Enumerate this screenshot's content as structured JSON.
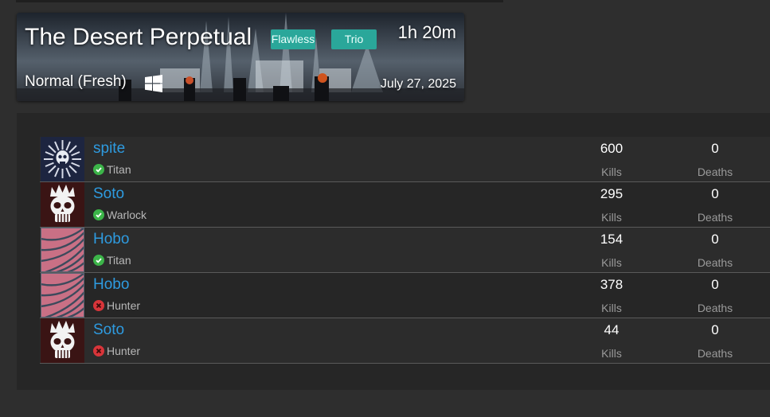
{
  "activity": {
    "title": "The Desert Perpetual",
    "badges": [
      "Flawless",
      "Trio"
    ],
    "duration": "1h 20m",
    "difficulty": "Normal (Fresh)",
    "platform_icon": "windows-icon",
    "date": "July 27, 2025"
  },
  "stat_labels": {
    "kills": "Kills",
    "deaths": "Deaths"
  },
  "players": [
    {
      "name": "spite",
      "class": "Titan",
      "completed": true,
      "kills": "600",
      "deaths": "0",
      "emblem": "skull-sunburst-emblem"
    },
    {
      "name": "Soto",
      "class": "Warlock",
      "completed": true,
      "kills": "295",
      "deaths": "0",
      "emblem": "crowned-skull-emblem"
    },
    {
      "name": "Hobo",
      "class": "Titan",
      "completed": true,
      "kills": "154",
      "deaths": "0",
      "emblem": "pink-swirl-emblem"
    },
    {
      "name": "Hobo",
      "class": "Hunter",
      "completed": false,
      "kills": "378",
      "deaths": "0",
      "emblem": "pink-swirl-emblem"
    },
    {
      "name": "Soto",
      "class": "Hunter",
      "completed": false,
      "kills": "44",
      "deaths": "0",
      "emblem": "crowned-skull-emblem"
    }
  ],
  "colors": {
    "accent": "#2aa79a",
    "name": "#2e9be0",
    "complete": "#3cb449",
    "incomplete": "#d8353a"
  }
}
